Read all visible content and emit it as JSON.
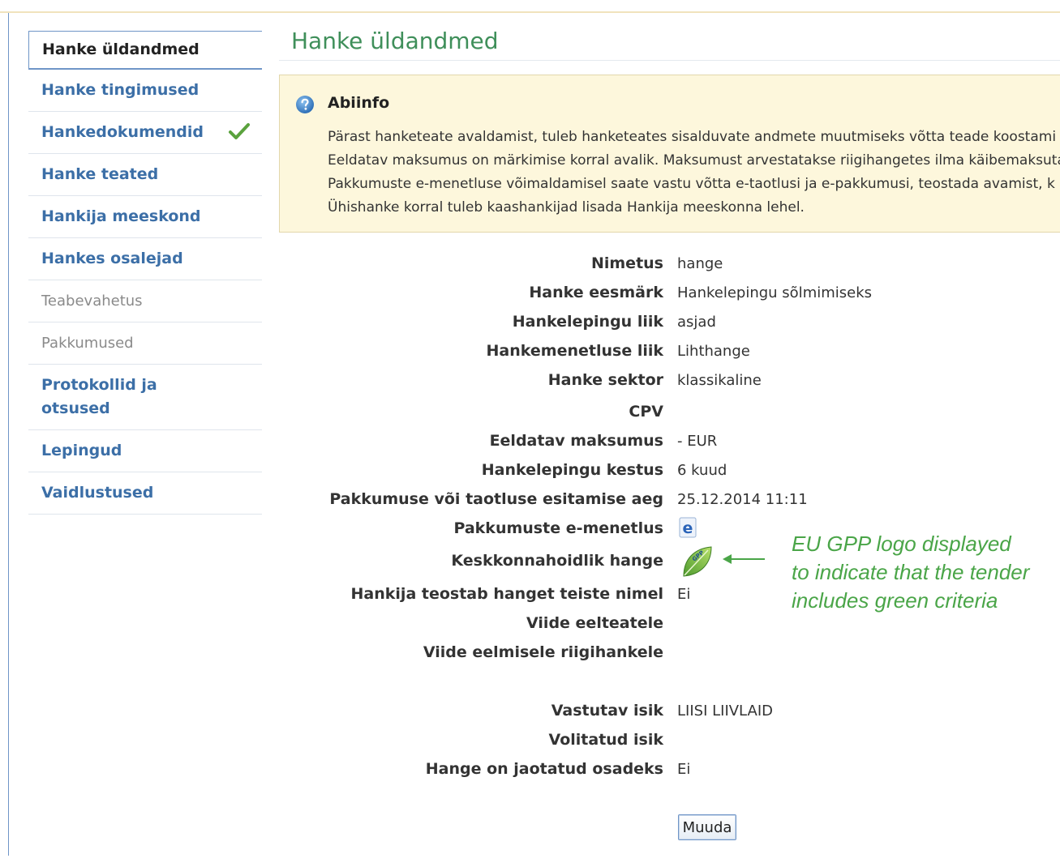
{
  "sidebar": {
    "items": [
      {
        "label": "Hanke üldandmed"
      },
      {
        "label": "Hanke tingimused"
      },
      {
        "label": "Hankedokumendid"
      },
      {
        "label": "Hanke teated"
      },
      {
        "label": "Hankija meeskond"
      },
      {
        "label": "Hankes osalejad"
      },
      {
        "label": "Teabevahetus"
      },
      {
        "label": "Pakkumused"
      },
      {
        "label": "Protokollid ja"
      },
      {
        "label": "otsused"
      },
      {
        "label": "Lepingud"
      },
      {
        "label": "Vaidlustused"
      }
    ]
  },
  "page": {
    "title": "Hanke üldandmed"
  },
  "help": {
    "title": "Abiinfo",
    "lines": [
      "Pärast hanketeate avaldamist, tuleb hanketeates sisalduvate andmete muutmiseks võtta teade koostami",
      "Eeldatav maksumus on märkimise korral avalik. Maksumust arvestatakse riigihangetes ilma käibemaksuta.",
      "Pakkumuste e-menetluse võimaldamisel saate vastu võtta e-taotlusi ja e-pakkumusi, teostada avamist, k",
      "Ühishanke korral tuleb kaashankijad lisada Hankija meeskonna lehel."
    ]
  },
  "details": {
    "rows": [
      {
        "label": "Nimetus",
        "value": "hange"
      },
      {
        "label": "Hanke eesmärk",
        "value": "Hankelepingu sõlmimiseks"
      },
      {
        "label": "Hankelepingu liik",
        "value": "asjad"
      },
      {
        "label": "Hankemenetluse liik",
        "value": "Lihthange"
      },
      {
        "label": "Hanke sektor",
        "value": "klassikaline"
      },
      {
        "label": "CPV",
        "value": ""
      },
      {
        "label": "Eeldatav maksumus",
        "value": "- EUR"
      },
      {
        "label": "Hankelepingu kestus",
        "value": "6 kuud"
      },
      {
        "label": "Pakkumuse või taotluse esitamise aeg",
        "value": "25.12.2014 11:11"
      },
      {
        "label": "Pakkumuste e-menetlus",
        "value": ""
      },
      {
        "label": "Keskkonnahoidlik hange",
        "value": ""
      },
      {
        "label": "Hankija teostab hanget teiste nimel",
        "value": "Ei"
      },
      {
        "label": "Viide eelteatele",
        "value": ""
      },
      {
        "label": "Viide eelmisele riigihankele",
        "value": ""
      },
      {
        "label": "Vastutav isik",
        "value": "LIISI LIIVLAID"
      },
      {
        "label": "Volitatud isik",
        "value": ""
      },
      {
        "label": "Hange on jaotatud osadeks",
        "value": "Ei"
      }
    ],
    "icons": {
      "e_procedure": "e-procedure-icon",
      "gpp": "eu-gpp-logo-icon",
      "completed": "checkmark-icon",
      "help": "question-icon"
    }
  },
  "annotation": {
    "lines": [
      "EU GPP logo displayed",
      "to indicate that the tender",
      "includes green criteria"
    ]
  },
  "actions": {
    "edit_label": "Muuda"
  },
  "colors": {
    "link": "#3c6fa7",
    "title": "#3f8f5a",
    "annotation": "#4aa548",
    "help_bg": "#fdf7dc"
  }
}
